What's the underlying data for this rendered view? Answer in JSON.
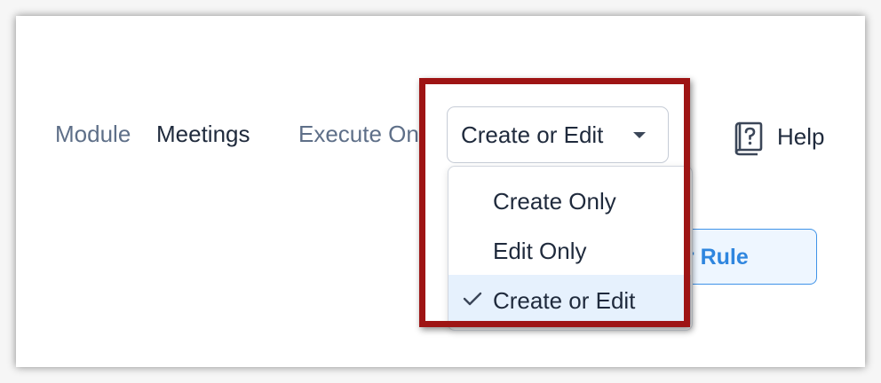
{
  "fields": {
    "module_label": "Module",
    "module_value": "Meetings",
    "execute_label": "Execute On"
  },
  "select": {
    "value": "Create or Edit",
    "caret_icon": "caret-down-icon",
    "options": [
      {
        "label": "Create Only",
        "selected": false
      },
      {
        "label": "Edit Only",
        "selected": false
      },
      {
        "label": "Create or Edit",
        "selected": true
      }
    ]
  },
  "help": {
    "label": "Help",
    "icon": "help-book-icon"
  },
  "background_button": {
    "visible_label": "er Rule"
  },
  "colors": {
    "highlight_frame": "#9e1414",
    "selected_option_bg": "#e6f1fd",
    "button_accent": "#2f86df",
    "label_gray": "#5e6f88",
    "text_dark": "#1f2a3c"
  }
}
